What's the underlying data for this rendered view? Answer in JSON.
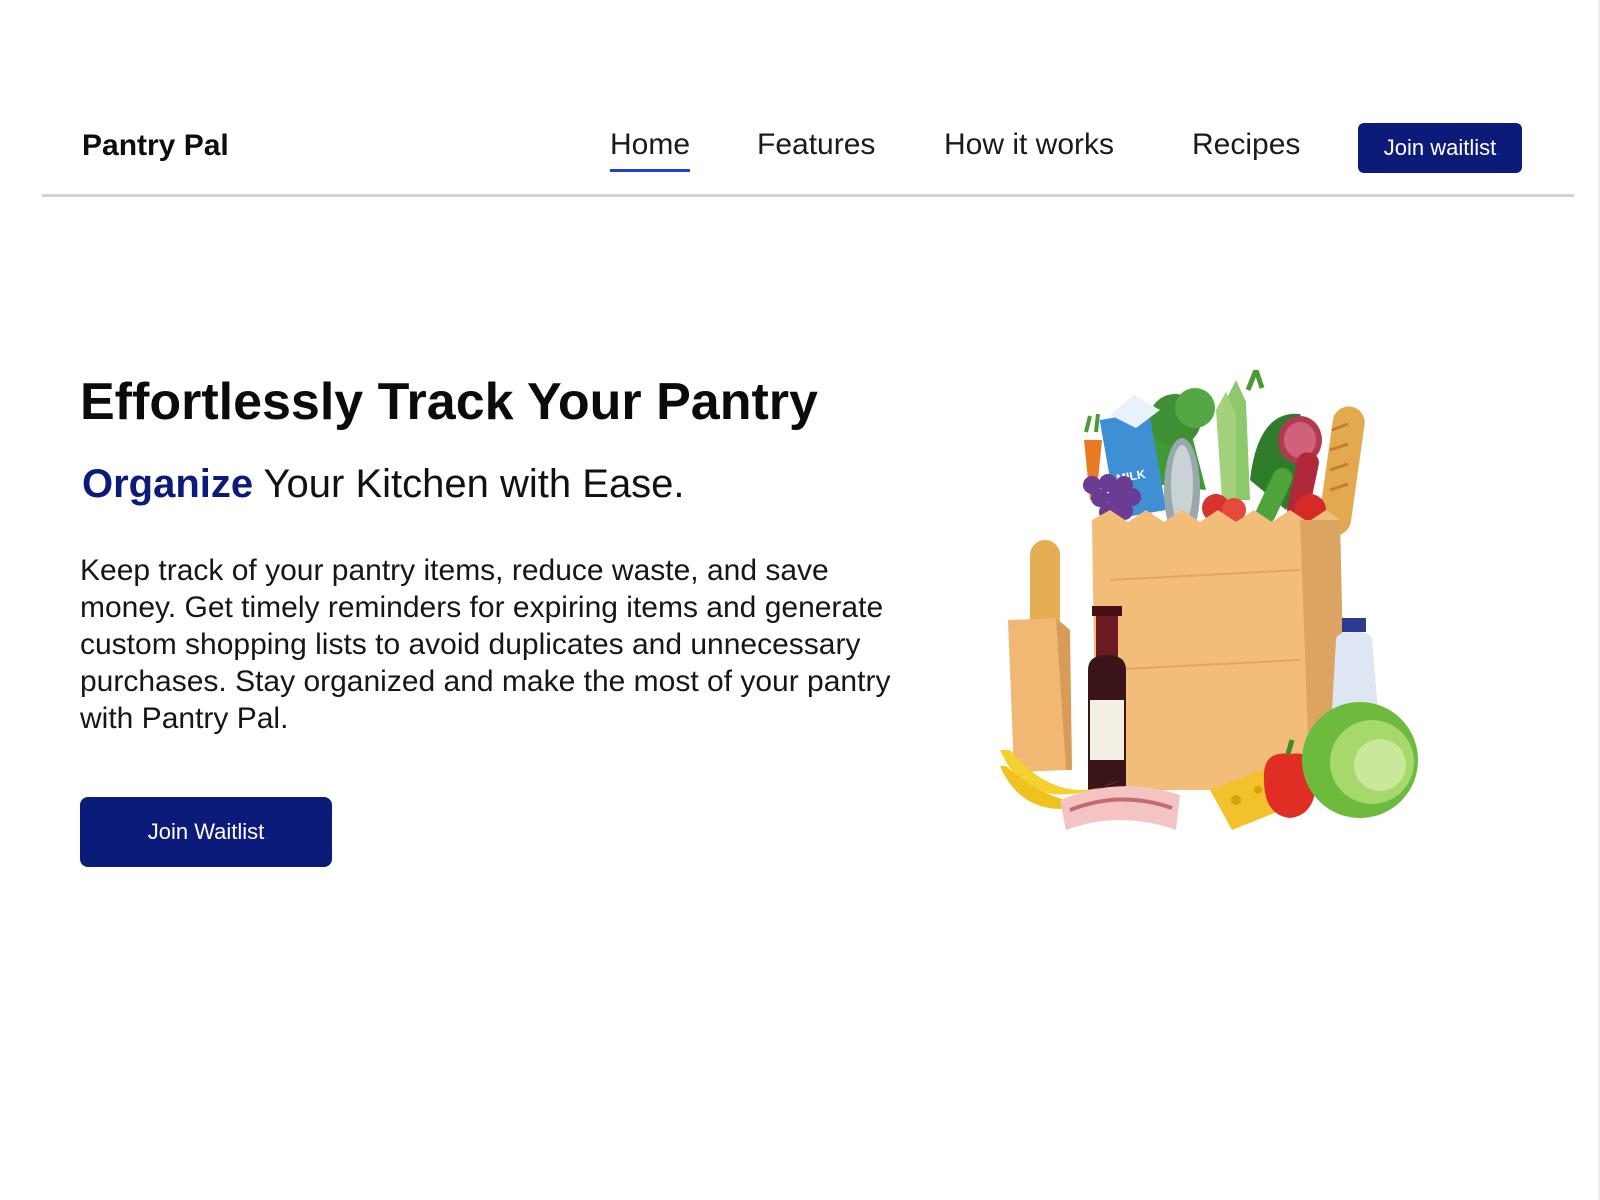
{
  "nav": {
    "brand": "Pantry Pal",
    "links": [
      {
        "label": "Home",
        "active": true
      },
      {
        "label": "Features",
        "active": false
      },
      {
        "label": "How it works",
        "active": false
      },
      {
        "label": "Recipes",
        "active": false
      }
    ],
    "cta_label": "Join waitlist"
  },
  "hero": {
    "title": "Effortlessly Track Your Pantry",
    "subtitle_highlight": "Organize",
    "subtitle_rest": " Your Kitchen with Ease.",
    "body": "Keep track of your pantry items, reduce waste, and save money. Get timely reminders for expiring items and generate custom shopping lists to avoid duplicates and unnecessary purchases. Stay organized and make the most of your pantry with Pantry Pal.",
    "cta_label": "Join Waitlist",
    "illustration": {
      "name": "grocery-bag-illustration",
      "milk_carton_text": "MILK"
    }
  },
  "colors": {
    "accent": "#0c1b7a",
    "active_underline": "#1d3fd6",
    "divider": "#d2d2d2"
  }
}
